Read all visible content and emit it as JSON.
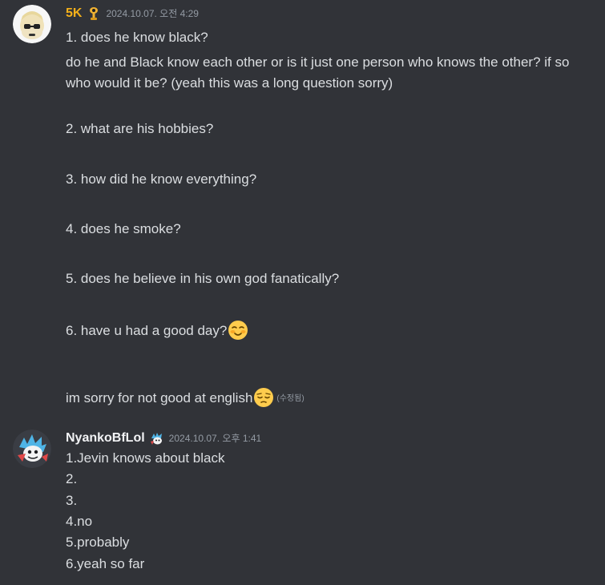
{
  "messages": [
    {
      "username": "5K",
      "username_color": "#f5b11a",
      "role_icon": "trophy-icon",
      "timestamp": "2024.10.07. 오전 4:29",
      "lines": [
        "1. does he know black?",
        "do he and Black know each other or is it just one person who knows the other? if so who would it be? (yeah this was a long question sorry)",
        "2. what are his hobbies?",
        "3. how did he know everything?",
        "4. does he smoke?",
        "5. does he believe in his own god fanatically?",
        "6. have u had a good day?",
        "im sorry for not good at english"
      ],
      "edited_label": "(수정됨)"
    },
    {
      "username": "NyankoBfLol",
      "username_color": "#f2f3f5",
      "role_icon": "character-badge-icon",
      "timestamp": "2024.10.07. 오후 1:41",
      "lines": [
        "1.Jevin knows about black",
        "2.",
        "3.",
        "4.no",
        "5.probably",
        "6.yeah so far"
      ]
    }
  ]
}
